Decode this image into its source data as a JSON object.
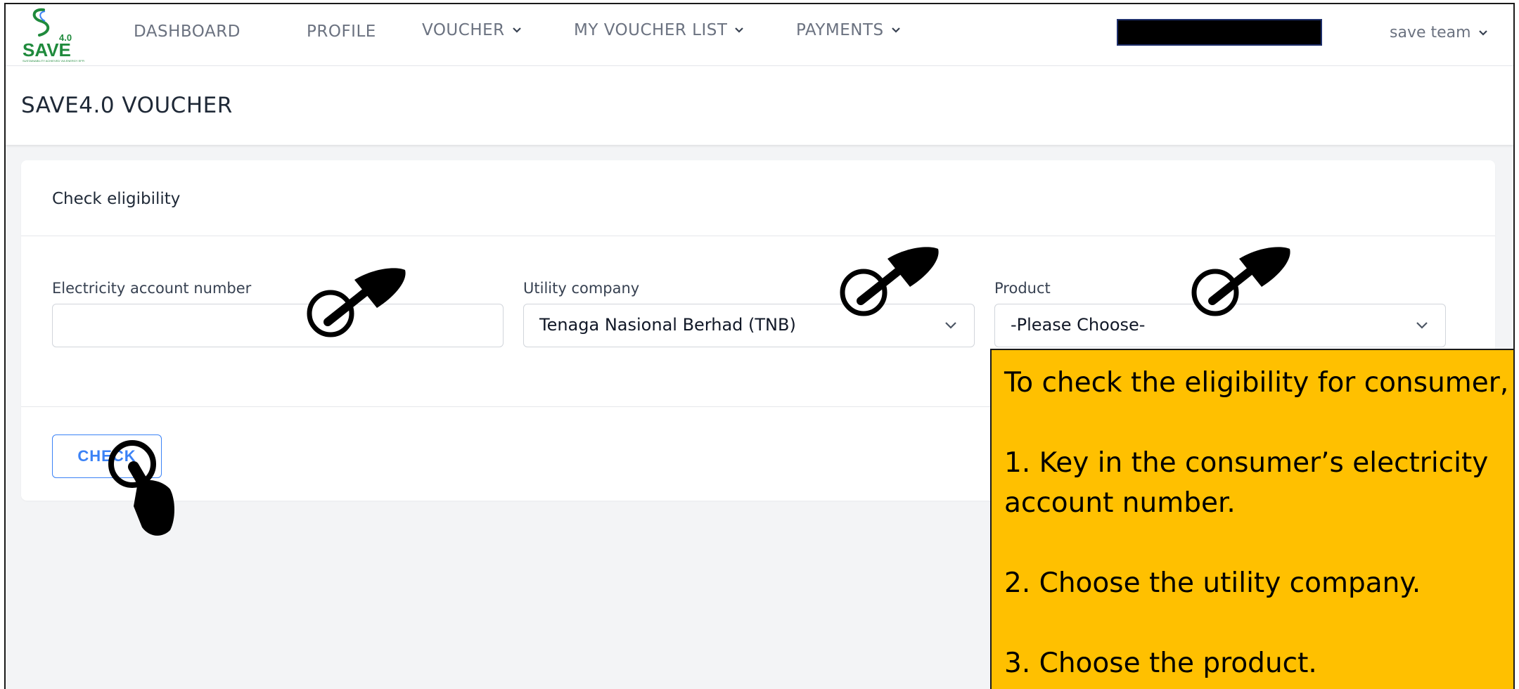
{
  "nav": {
    "logo_top": "4.0",
    "logo_text": "SAVE",
    "logo_tagline": "SUSTAINABILITY ACHIEVED VIA ENERGY EFFICIENCY",
    "items": [
      {
        "label": "DASHBOARD"
      },
      {
        "label": "PROFILE"
      },
      {
        "label": "VOUCHER"
      },
      {
        "label": "MY VOUCHER LIST"
      },
      {
        "label": "PAYMENTS"
      }
    ],
    "user": "save team"
  },
  "page": {
    "title": "SAVE4.0 VOUCHER"
  },
  "card": {
    "title": "Check eligibility",
    "fields": {
      "account": {
        "label": "Electricity account number",
        "value": ""
      },
      "utility": {
        "label": "Utility company",
        "value": "Tenaga Nasional Berhad (TNB)"
      },
      "product": {
        "label": "Product",
        "value": "-Please Choose-"
      }
    },
    "check_label": "CHECK"
  },
  "callout": {
    "intro": "To check the eligibility for consumer,",
    "step1_a": "1. Key in the consumer’s electricity",
    "step1_b": "account number.",
    "step2": "2. Choose the utility company.",
    "step3": "3. Choose the product."
  },
  "colors": {
    "accent": "#3b82f6",
    "callout": "#ffc000",
    "brand": "#1f8a3c"
  }
}
